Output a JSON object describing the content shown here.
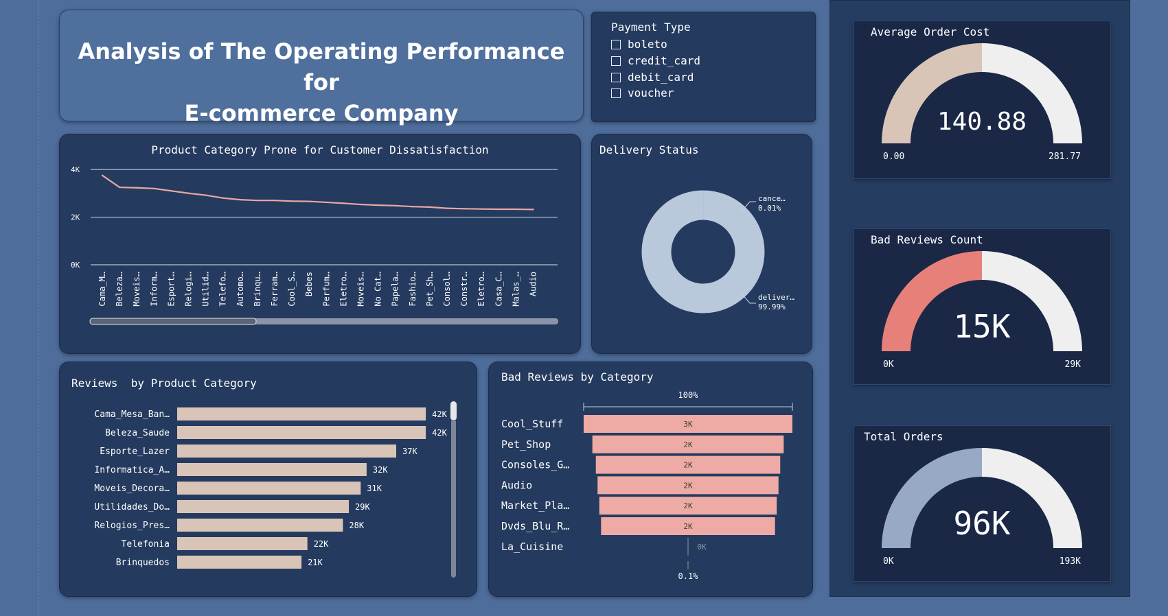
{
  "title": "Analysis of The Operating Performance for\nE-commerce Company",
  "payment_slicer": {
    "title": "Payment Type",
    "options": [
      "boleto",
      "credit_card",
      "debit_card",
      "voucher"
    ]
  },
  "line_chart_title": "Product Category Prone for Customer Dissatisfaction",
  "delivery_title": "Delivery Status",
  "reviews_title": "Reviews  by Product Category",
  "bad_reviews_title": "Bad Reviews by Category",
  "gauges": {
    "avg_order": {
      "title": "Average Order Cost",
      "value_label": "140.88",
      "min_label": "0.00",
      "max_label": "281.77",
      "fraction": 0.5,
      "color": "#d9c5b8"
    },
    "bad_reviews": {
      "title": "Bad Reviews Count",
      "value_label": "15K",
      "min_label": "0K",
      "max_label": "29K",
      "fraction": 0.5,
      "color": "#e8807a"
    },
    "total_orders": {
      "title": "Total Orders",
      "value_label": "96K",
      "min_label": "0K",
      "max_label": "193K",
      "fraction": 0.5,
      "color": "#97a9c5"
    }
  },
  "colors": {
    "page_bg": "#4e6d9b",
    "card_bg": "#243a5e",
    "line": "#e8a8a3",
    "bar_beige": "#d9c5b8",
    "bar_pink": "#eeaaa5",
    "donut": "#bac8dc",
    "gauge_track": "#efefef"
  },
  "chart_data": [
    {
      "type": "line",
      "title": "Product Category Prone for Customer Dissatisfaction",
      "categories": [
        "Cama_M…",
        "Beleza…",
        "Moveis…",
        "Inform…",
        "Esport…",
        "Relogi…",
        "Utilid…",
        "Telefo…",
        "Automo…",
        "Brinqu…",
        "Ferram…",
        "Cool_S…",
        "Bebes",
        "Perfum…",
        "Eletro…",
        "Moveis…",
        "No Cat…",
        "Papela…",
        "Fashio…",
        "Pet_Sh…",
        "Consol…",
        "Constr…",
        "Eletro…",
        "Casa_C…",
        "Malas_…",
        "Audio"
      ],
      "values": [
        3750,
        3250,
        3230,
        3200,
        3100,
        3000,
        2920,
        2800,
        2730,
        2700,
        2700,
        2670,
        2660,
        2620,
        2580,
        2530,
        2500,
        2480,
        2440,
        2420,
        2370,
        2350,
        2340,
        2330,
        2330,
        2320
      ],
      "ylim": [
        0,
        4000
      ],
      "yticks": [
        "0K",
        "2K",
        "4K"
      ],
      "grid": true
    },
    {
      "type": "pie",
      "title": "Delivery Status",
      "labels": [
        "cance…",
        "deliver…"
      ],
      "values": [
        0.01,
        99.99
      ],
      "value_labels": [
        "0.01%",
        "99.99%"
      ]
    },
    {
      "type": "bar",
      "title": "Reviews  by Product Category",
      "orientation": "horizontal",
      "categories": [
        "Cama_Mesa_Ban…",
        "Beleza_Saude",
        "Esporte_Lazer",
        "Informatica_A…",
        "Moveis_Decora…",
        "Utilidades_Do…",
        "Relogios_Pres…",
        "Telefonia",
        "Brinquedos"
      ],
      "values": [
        42,
        42,
        37,
        32,
        31,
        29,
        28,
        22,
        21
      ],
      "value_labels": [
        "42K",
        "42K",
        "37K",
        "32K",
        "31K",
        "29K",
        "28K",
        "22K",
        "21K"
      ],
      "xlim": [
        0,
        45
      ]
    },
    {
      "type": "bar",
      "title": "Bad Reviews by Category",
      "orientation": "funnel",
      "categories": [
        "Cool_Stuff",
        "Pet_Shop",
        "Consoles_G…",
        "Audio",
        "Market_Pla…",
        "Dvds_Blu_R…",
        "La_Cuisine"
      ],
      "values": [
        3,
        2.75,
        2.65,
        2.6,
        2.55,
        2.5,
        0.003
      ],
      "value_labels": [
        "3K",
        "2K",
        "2K",
        "2K",
        "2K",
        "2K",
        "0K"
      ],
      "top_label": "100%",
      "bottom_label": "0.1%"
    }
  ]
}
